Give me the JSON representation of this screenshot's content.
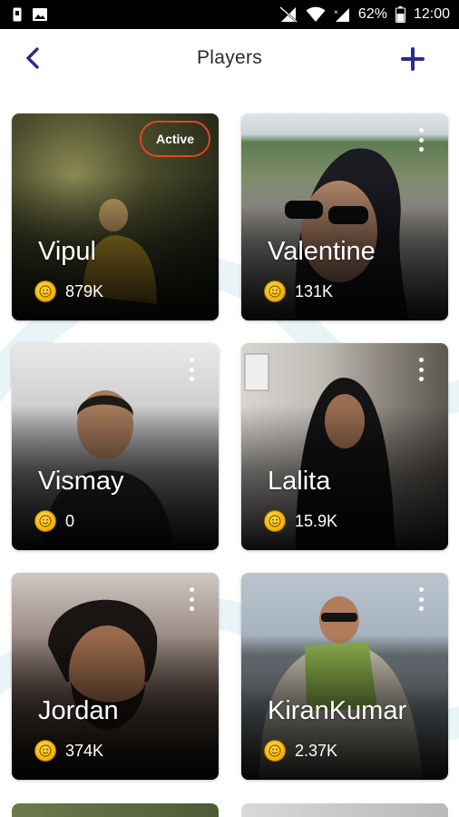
{
  "status_bar": {
    "battery_percent": "62%",
    "time": "12:00",
    "left_icons": [
      "sim-icon",
      "image-icon"
    ],
    "right_icons": [
      "no-signal-icon",
      "wifi-icon",
      "mobile-data-icon",
      "battery-icon"
    ]
  },
  "header": {
    "title": "Players",
    "back_icon": "chevron-left-icon",
    "add_icon": "plus-icon",
    "accent_color": "#2b2c8f"
  },
  "players": [
    {
      "name": "Vipul",
      "coins": "879K",
      "active": true,
      "badge": "Active"
    },
    {
      "name": "Valentine",
      "coins": "131K",
      "active": false
    },
    {
      "name": "Vismay",
      "coins": "0",
      "active": false
    },
    {
      "name": "Lalita",
      "coins": "15.9K",
      "active": false
    },
    {
      "name": "Jordan",
      "coins": "374K",
      "active": false
    },
    {
      "name": "KiranKumar",
      "coins": "2.37K",
      "active": false
    }
  ],
  "colors": {
    "active_badge_border": "#e2461e",
    "coin": "#f3b300",
    "status_bar": "#000000"
  }
}
